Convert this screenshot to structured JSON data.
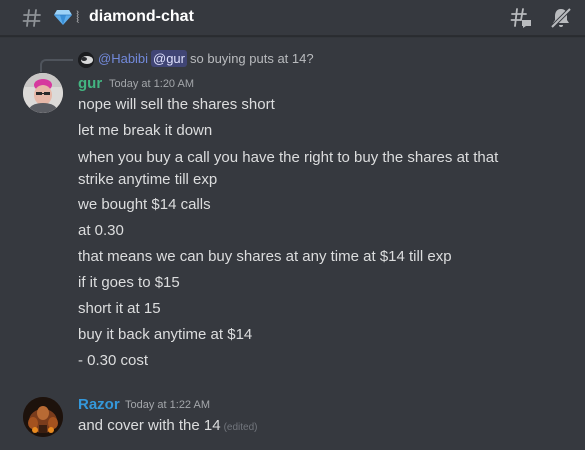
{
  "header": {
    "channel_name": "diamond-chat",
    "thread_glyph": "⦚"
  },
  "reply": {
    "mention_author": "@Habibi",
    "mention_user": "@gur",
    "text": "so buying puts at 14?"
  },
  "messages": [
    {
      "author": "gur",
      "timestamp": "Today at 1:20 AM",
      "lines": [
        "nope will sell the shares short",
        "let me break it down",
        "when you buy a call you have the right to buy the shares at that",
        "strike anytime till exp",
        "we bought $14 calls",
        "at 0.30",
        "that means we can buy shares at any time at $14 till exp",
        "if it goes to $15",
        "short it at 15",
        "buy it back anytime at $14",
        "- 0.30 cost"
      ]
    },
    {
      "author": "Razor",
      "timestamp": "Today at 1:22 AM",
      "lines": [
        "and cover with the 14"
      ],
      "edited_label": "(edited)"
    }
  ],
  "colors": {
    "background": "#36393f",
    "gur_name": "#43b581",
    "razor_name": "#3498db",
    "mention": "#7289da"
  },
  "icons": [
    "hash-icon",
    "gem-icon",
    "threads-icon",
    "mute-icon"
  ]
}
